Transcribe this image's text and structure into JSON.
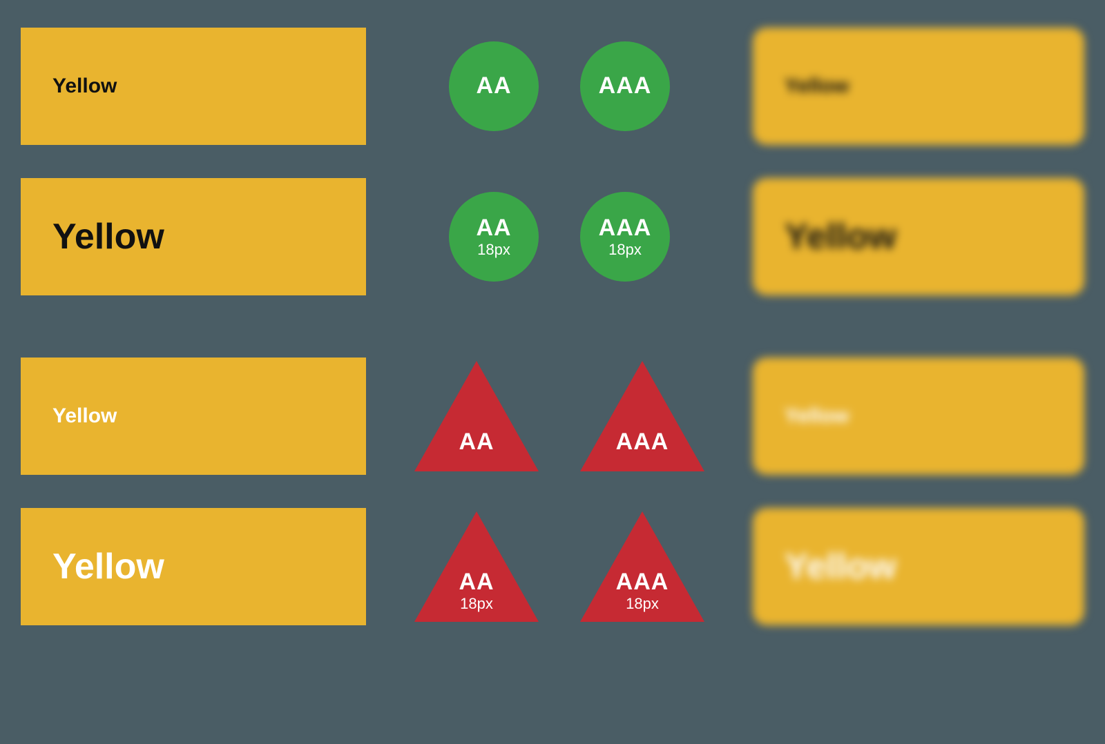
{
  "colors": {
    "swatch_bg": "#e9b42f",
    "pass": "#3aa648",
    "fail": "#c62a33",
    "text_dark": "#111111",
    "text_light": "#ffffff"
  },
  "rows": [
    {
      "swatch_label": "Yellow",
      "text_color_key": "text_dark",
      "size": "small",
      "aa": {
        "label": "AA",
        "sub": "",
        "shape": "circle",
        "color_key": "pass"
      },
      "aaa": {
        "label": "AAA",
        "sub": "",
        "shape": "circle",
        "color_key": "pass"
      },
      "preview_label": "Yellow"
    },
    {
      "swatch_label": "Yellow",
      "text_color_key": "text_dark",
      "size": "large",
      "aa": {
        "label": "AA",
        "sub": "18px",
        "shape": "circle",
        "color_key": "pass"
      },
      "aaa": {
        "label": "AAA",
        "sub": "18px",
        "shape": "circle",
        "color_key": "pass"
      },
      "preview_label": "Yellow"
    },
    {
      "swatch_label": "Yellow",
      "text_color_key": "text_light",
      "size": "small",
      "aa": {
        "label": "AA",
        "sub": "",
        "shape": "triangle",
        "color_key": "fail"
      },
      "aaa": {
        "label": "AAA",
        "sub": "",
        "shape": "triangle",
        "color_key": "fail"
      },
      "preview_label": "Yellow"
    },
    {
      "swatch_label": "Yellow",
      "text_color_key": "text_light",
      "size": "large",
      "aa": {
        "label": "AA",
        "sub": "18px",
        "shape": "triangle",
        "color_key": "fail"
      },
      "aaa": {
        "label": "AAA",
        "sub": "18px",
        "shape": "triangle",
        "color_key": "fail"
      },
      "preview_label": "Yellow"
    }
  ]
}
